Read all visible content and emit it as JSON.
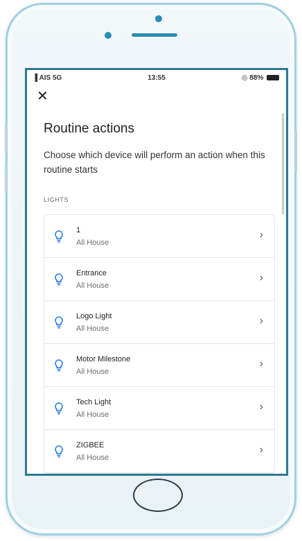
{
  "status_bar": {
    "carrier": "AIS 5G",
    "time": "13:55",
    "battery": "88%"
  },
  "header": {
    "close_label": "✕",
    "title": "Routine actions",
    "description": "Choose which device will perform an action when this routine starts"
  },
  "section": {
    "label": "LIGHTS"
  },
  "lights": [
    {
      "name": "1",
      "room": "All House",
      "icon": "lightbulb-icon"
    },
    {
      "name": "Entrance",
      "room": "All House",
      "icon": "lightbulb-icon"
    },
    {
      "name": "Logo Light",
      "room": "All House",
      "icon": "lightbulb-icon"
    },
    {
      "name": "Motor Milestone",
      "room": "All House",
      "icon": "lightbulb-icon"
    },
    {
      "name": "Tech Light",
      "room": "All House",
      "icon": "lightbulb-icon"
    },
    {
      "name": "ZIGBEE",
      "room": "All House",
      "icon": "lightbulb-icon"
    }
  ],
  "colors": {
    "accent": "#1a73e8",
    "frame": "#9fd0e3",
    "screen_border": "#2b7a93"
  }
}
